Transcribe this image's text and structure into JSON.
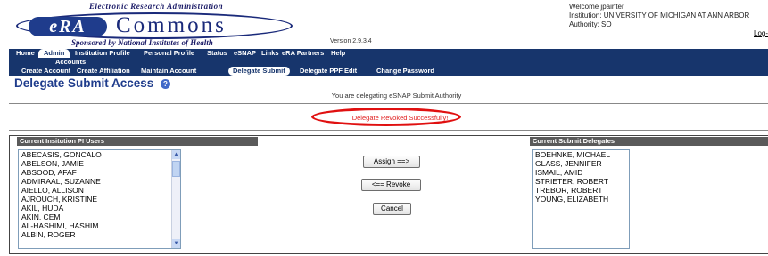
{
  "header": {
    "logo_top_text": "Electronic Research Administration",
    "logo_era": "eRA",
    "logo_commons": "Commons",
    "logo_sponsor": "Sponsored by National Institutes of Health",
    "version": "Version 2.9.3.4",
    "welcome": "Welcome  jpainter",
    "institution": "Institution: UNIVERSITY OF MICHIGAN AT ANN ARBOR",
    "authority": "Authority:   SO",
    "logout": "Log-"
  },
  "nav": {
    "main": [
      "Home",
      "Admin",
      "Institution Profile",
      "Personal Profile",
      "Status",
      "eSNAP",
      "Links",
      "eRA Partners",
      "Help"
    ],
    "active_main": "Admin",
    "sub1": "Accounts",
    "sub2": [
      "Create Account",
      "Create Affiliation",
      "Maintain Account",
      "Delegate Submit",
      "Delegate PPF Edit",
      "Change Password"
    ],
    "active_sub2": "Delegate Submit"
  },
  "page": {
    "title": "Delegate Submit Access",
    "help_icon": "help-icon",
    "delegating_message": "You are delegating eSNAP Submit Authority",
    "revoked_message": "Delegate Revoked Successfully!",
    "highlight_color": "#e01010"
  },
  "left_panel": {
    "header": "Current Insitution PI Users",
    "users": [
      "ABECASIS, GONCALO",
      "ABELSON, JAMIE",
      "ABSOOD, AFAF",
      "ADMIRAAL, SUZANNE",
      "AIELLO, ALLISON",
      "AJROUCH, KRISTINE",
      "AKIL, HUDA",
      "AKIN, CEM",
      "AL-HASHIMI, HASHIM",
      "ALBIN, ROGER"
    ]
  },
  "buttons": {
    "assign": "Assign ==>",
    "revoke": "<== Revoke",
    "cancel": "Cancel"
  },
  "right_panel": {
    "header": "Current Submit Delegates",
    "delegates": [
      "BOEHNKE, MICHAEL",
      "GLASS, JENNIFER",
      "ISMAIL, AMID",
      "STRIETER, ROBERT",
      "TREBOR, ROBERT",
      "YOUNG, ELIZABETH"
    ]
  },
  "colors": {
    "nav_bg": "#17356c",
    "title_color": "#1f3c8c",
    "panel_header_bg": "#5a5a5a"
  }
}
